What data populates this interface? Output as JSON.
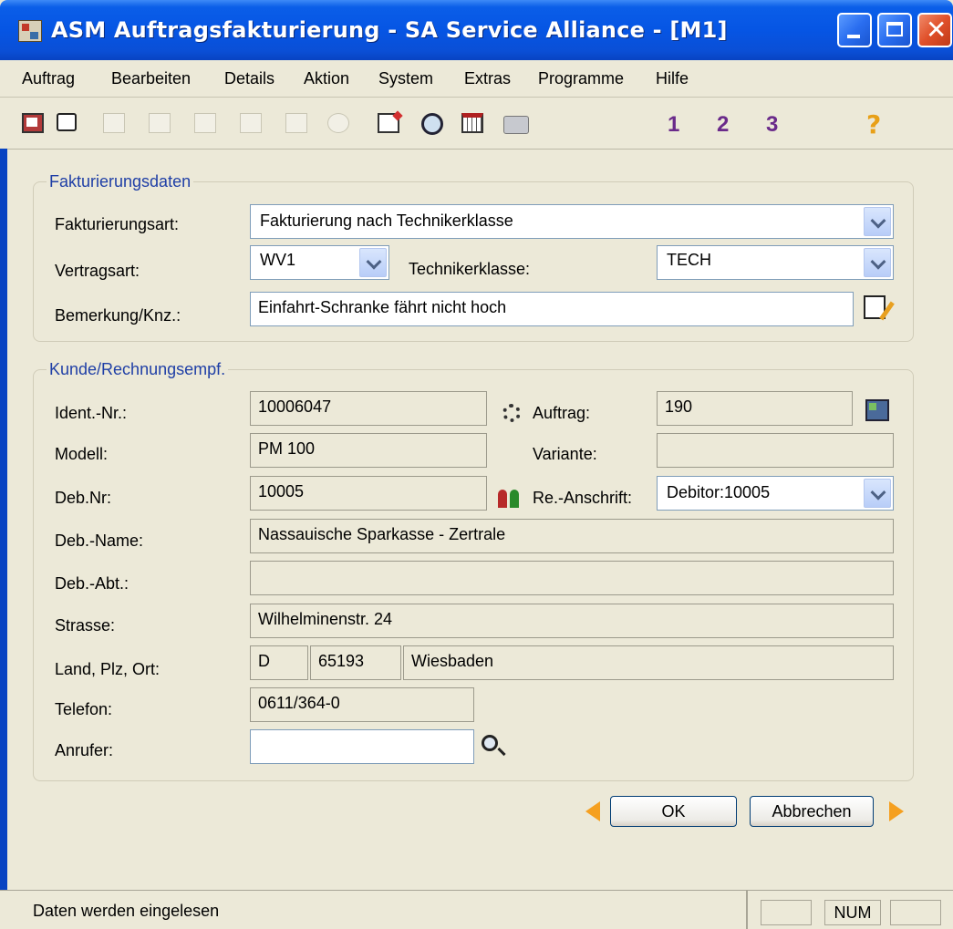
{
  "window": {
    "title": "ASM Auftragsfakturierung - SA Service Alliance  - [M1]"
  },
  "menu": [
    "Auftrag",
    "Bearbeiten",
    "Details",
    "Aktion",
    "System",
    "Extras",
    "Programme",
    "Hilfe"
  ],
  "toolbar": {
    "help_glyph": "?",
    "nav1": "1",
    "nav2": "2",
    "nav3": "3"
  },
  "fakturierung": {
    "group_title": "Fakturierungsdaten",
    "art_label": "Fakturierungsart:",
    "art_value": "Fakturierung nach Technikerklasse",
    "vertragsart_label": "Vertragsart:",
    "vertragsart_value": "WV1",
    "technikerklasse_label": "Technikerklasse:",
    "technikerklasse_value": "TECH",
    "bemerkung_label": "Bemerkung/Knz.:",
    "bemerkung_value": "Einfahrt-Schranke fährt nicht hoch"
  },
  "kunde": {
    "group_title": "Kunde/Rechnungsempf.",
    "ident_label": "Ident.-Nr.:",
    "ident_value": "10006047",
    "auftrag_label": "Auftrag:",
    "auftrag_value": "190",
    "modell_label": "Modell:",
    "modell_value": "PM 100",
    "variante_label": "Variante:",
    "variante_value": "",
    "debnr_label": "Deb.Nr:",
    "debnr_value": "10005",
    "reanschrift_label": "Re.-Anschrift:",
    "reanschrift_value": "Debitor:10005",
    "debname_label": "Deb.-Name:",
    "debname_value": "Nassauische Sparkasse - Zertrale",
    "debabt_label": "Deb.-Abt.:",
    "debabt_value": "",
    "strasse_label": "Strasse:",
    "strasse_value": "Wilhelminenstr.  24",
    "lpo_label": "Land, Plz, Ort:",
    "land_value": "D",
    "plz_value": "65193",
    "ort_value": "Wiesbaden",
    "telefon_label": "Telefon:",
    "telefon_value": "0611/364-0",
    "anrufer_label": "Anrufer:",
    "anrufer_value": ""
  },
  "buttons": {
    "ok": "OK",
    "cancel": "Abbrechen"
  },
  "status": {
    "text": "Daten werden eingelesen",
    "num": "NUM"
  }
}
